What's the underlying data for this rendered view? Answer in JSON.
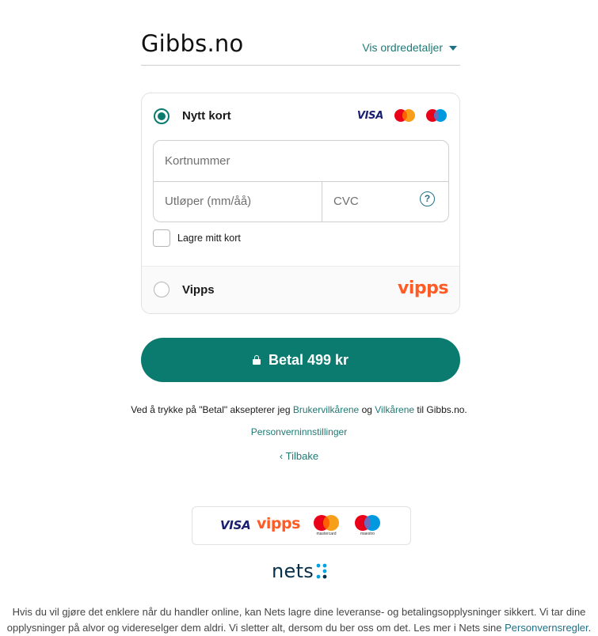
{
  "header": {
    "merchant": "Gibbs.no",
    "order_details_label": "Vis ordredetaljer"
  },
  "payment_options": {
    "card": {
      "label": "Nytt kort",
      "brands": [
        "VISA",
        "mastercard",
        "maestro"
      ],
      "card_number_placeholder": "Kortnummer",
      "expiry_placeholder": "Utløper (mm/åå)",
      "cvc_placeholder": "CVC",
      "save_card_label": "Lagre mitt kort"
    },
    "vipps": {
      "label": "Vipps",
      "logo_text": "vipps"
    }
  },
  "pay_button": {
    "label": "Betal 499 kr"
  },
  "terms": {
    "prefix": "Ved å trykke på \"Betal\" aksepterer jeg ",
    "link1": "Brukervilkårene",
    "middle": " og ",
    "link2": "Vilkårene",
    "suffix": " til Gibbs.no."
  },
  "privacy_settings_label": "Personverninnstillinger",
  "back_label": "Tilbake",
  "accepted_logos": {
    "visa": "VISA",
    "vipps": "vipps",
    "mastercard": "mastercard",
    "maestro": "maestro"
  },
  "provider": {
    "name": "nets"
  },
  "footer": {
    "text": "Hvis du vil gjøre det enklere når du handler online, kan Nets lagre dine leveranse- og betalingsopplysninger sikkert. Vi tar dine opplysninger på alvor og videreselger dem aldri. Vi sletter alt, dersom du ber oss om det. Les mer i Nets sine ",
    "link": "Personvernsregler",
    "end": "."
  },
  "colors": {
    "accent": "#0b7b6f",
    "link": "#1f7a74",
    "vipps": "#ff5b24",
    "visa": "#1a1f71",
    "mastercard_red": "#eb001b",
    "mastercard_orange": "#f79e1b",
    "maestro_blue": "#0099df",
    "nets": "#06304a"
  }
}
